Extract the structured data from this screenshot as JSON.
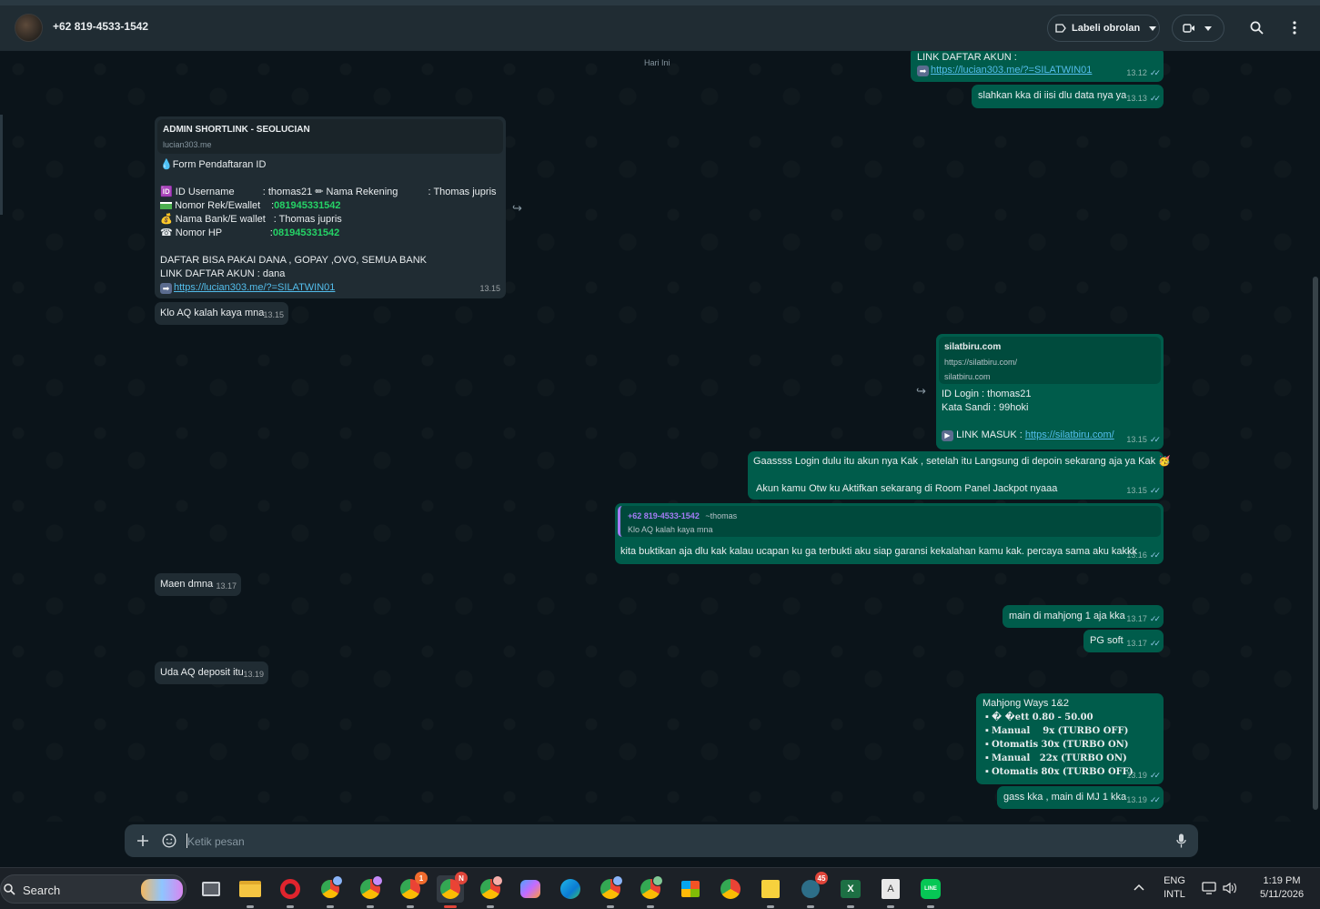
{
  "header": {
    "contact_name": "+62 819-4533-1542",
    "label_button": "Labeli obrolan"
  },
  "chat": {
    "date_chip": "Hari Ini",
    "messages": [
      {
        "lines": [
          "LINK DAFTAR AKUN :"
        ],
        "link": "https://lucian303.me/?=SILATWIN01",
        "time": "13.12"
      },
      {
        "text": "slahkan kka di iisi dlu data nya ya",
        "time": "13.13"
      },
      {
        "preview_title": "ADMIN SHORTLINK - SEOLUCIAN",
        "preview_domain": "lucian303.me",
        "form_title": "Form Pendaftaran ID",
        "row1_label": "ID Username",
        "row1_value": ": thomas21",
        "row1_extra_label": "Nama  Rekening",
        "row1_extra_value": ": Thomas jupris",
        "row2_label": "Nomor Rek/Ewallet",
        "row2_sep": ":",
        "row2_value": "081945331542",
        "row3_label": "Nama Bank/E wallet",
        "row3_value": ": Thomas jupris",
        "row4_label": "Nomor HP",
        "row4_sep": ":",
        "row4_value": "081945331542",
        "line_a": "DAFTAR BISA PAKAI DANA , GOPAY ,OVO, SEMUA BANK",
        "line_b": "LINK DAFTAR AKUN : dana",
        "link": "https://lucian303.me/?=SILATWIN01",
        "time": "13.15"
      },
      {
        "text": "Klo AQ kalah kaya mna",
        "time": "13.15"
      },
      {
        "preview_title": "silatbiru.com",
        "preview_url": "https://silatbiru.com/",
        "preview_domain": "silatbiru.com",
        "line_a": "ID Login : thomas21",
        "line_b": "Kata Sandi : 99hoki",
        "link_label": "LINK MASUK  :",
        "link": "https://silatbiru.com/",
        "time": "13.15"
      },
      {
        "line_a": "Gaassss Login dulu itu akun nya Kak  , setelah itu Langsung di depoin sekarang aja ya Kak",
        "line_b": "Akun kamu Otw ku Aktifkan sekarang di Room Panel Jackpot nyaaa",
        "time": "13.15"
      },
      {
        "quote_author": "+62 819-4533-1542",
        "quote_alias": "~thomas",
        "quote_text": "Klo AQ kalah kaya mna",
        "text": "kita buktikan aja dlu kak kalau ucapan ku ga terbukti aku siap garansi kekalahan kamu kak. percaya sama aku kakkk",
        "time": "13.16"
      },
      {
        "text": "Maen dmna",
        "time": "13.17"
      },
      {
        "text": "main di mahjong 1 aja kka",
        "time": "13.17"
      },
      {
        "text": "PG soft",
        "time": "13.17"
      },
      {
        "text": "Uda AQ deposit itu",
        "time": "13.19"
      },
      {
        "title": "Mahjong Ways 1&2",
        "rows": [
          "� �ett 0.80 - 50.00",
          "Manual    9x (TURBO OFF)",
          "Otomatis 30x (TURBO ON)",
          "Manual   22x (TURBO ON)",
          "Otomatis 80x (TURBO OFF)"
        ],
        "time": "13.19"
      },
      {
        "text": "gass kka , main di MJ 1 kka",
        "time": "13.19"
      }
    ]
  },
  "composer": {
    "placeholder": "Ketik pesan"
  },
  "taskbar": {
    "search_label": "Search",
    "badge_opera": "1",
    "badge_chrome_n": "N",
    "badge_45": "45",
    "lang_top": "ENG",
    "lang_bottom": "INTL",
    "time": "1:19 PM",
    "date": "5/11/2026"
  },
  "colors": {
    "incoming": "#202c33",
    "outgoing": "#005c4b",
    "link": "#53bdeb",
    "accent": "#25d366"
  }
}
